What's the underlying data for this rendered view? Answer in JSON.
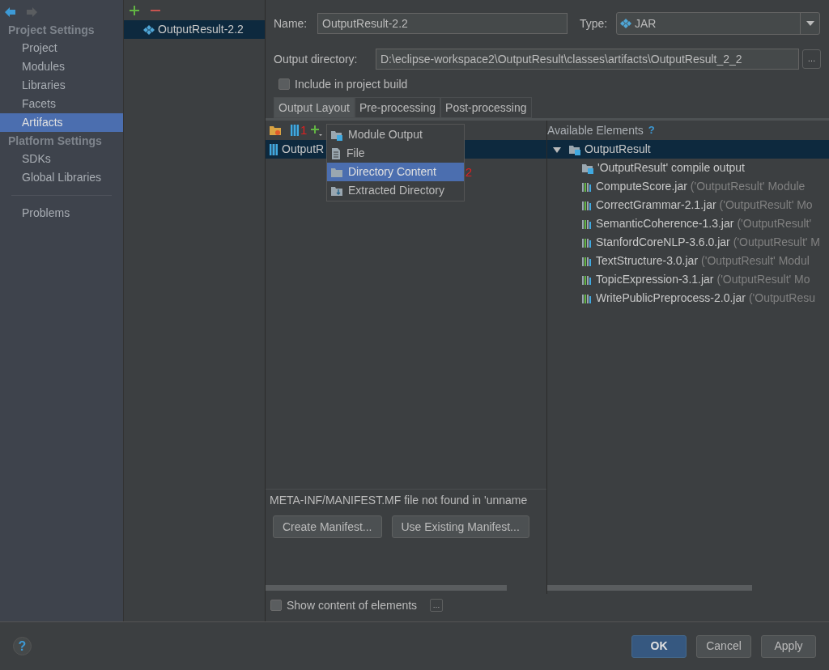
{
  "sidebar": {
    "sections": [
      {
        "title": "Project Settings",
        "items": [
          {
            "label": "Project",
            "selected": false
          },
          {
            "label": "Modules",
            "selected": false
          },
          {
            "label": "Libraries",
            "selected": false
          },
          {
            "label": "Facets",
            "selected": false
          },
          {
            "label": "Artifacts",
            "selected": true
          }
        ]
      },
      {
        "title": "Platform Settings",
        "items": [
          {
            "label": "SDKs",
            "selected": false
          },
          {
            "label": "Global Libraries",
            "selected": false
          }
        ]
      }
    ],
    "extra_items": [
      {
        "label": "Problems",
        "selected": false
      }
    ]
  },
  "artifacts_list": [
    {
      "label": "OutputResult-2.2",
      "selected": true
    }
  ],
  "name_field": {
    "label": "Name:",
    "value": "OutputResult-2.2"
  },
  "type_field": {
    "label": "Type:",
    "value": "JAR"
  },
  "output_directory": {
    "label": "Output directory:",
    "value": "D:\\eclipse-workspace2\\OutputResult\\classes\\artifacts\\OutputResult_2_2",
    "browse": "…"
  },
  "include_in_build": {
    "label": "Include in project build",
    "checked": false
  },
  "tabs": [
    {
      "label": "Output Layout",
      "selected": true
    },
    {
      "label": "Pre-processing",
      "selected": false
    },
    {
      "label": "Post-processing",
      "selected": false
    }
  ],
  "layout_toolbar": {
    "annotation": "1"
  },
  "layout_tree": [
    {
      "label": "OutputR",
      "selected": true
    }
  ],
  "add_menu": {
    "annotation": "2",
    "items": [
      {
        "label": "Module Output",
        "kind": "module",
        "selected": false
      },
      {
        "label": "File",
        "kind": "file",
        "selected": false
      },
      {
        "label": "Directory Content",
        "kind": "directory",
        "selected": true
      },
      {
        "label": "Extracted Directory",
        "kind": "extracted",
        "selected": false
      }
    ]
  },
  "available": {
    "title": "Available Elements",
    "help": "?",
    "tree": [
      {
        "label": "OutputResult",
        "kind": "module",
        "expanded": true,
        "selected": true,
        "children": [
          {
            "label": "'OutputResult' compile output",
            "kind": "output",
            "selected": false
          },
          {
            "label": "ComputeScore.jar",
            "detail": "('OutputResult' Module",
            "kind": "library",
            "selected": false
          },
          {
            "label": "CorrectGrammar-2.1.jar",
            "detail": "('OutputResult' Mo",
            "kind": "library",
            "selected": false
          },
          {
            "label": "SemanticCoherence-1.3.jar",
            "detail": "('OutputResult'",
            "kind": "library",
            "selected": false
          },
          {
            "label": "StanfordCoreNLP-3.6.0.jar",
            "detail": "('OutputResult' M",
            "kind": "library",
            "selected": false
          },
          {
            "label": "TextStructure-3.0.jar",
            "detail": "('OutputResult' Modul",
            "kind": "library",
            "selected": false
          },
          {
            "label": "TopicExpression-3.1.jar",
            "detail": "('OutputResult' Mo",
            "kind": "library",
            "selected": false
          },
          {
            "label": "WritePublicPreprocess-2.0.jar",
            "detail": "('OutputResu",
            "kind": "library",
            "selected": false
          }
        ]
      }
    ]
  },
  "manifest": {
    "message": "META-INF/MANIFEST.MF file not found in 'unname",
    "buttons": [
      "Create Manifest...",
      "Use Existing Manifest..."
    ]
  },
  "show_content": {
    "label": "Show content of elements",
    "checked": false,
    "more": "…"
  },
  "help": "?",
  "buttons": [
    {
      "label": "OK",
      "default": true
    },
    {
      "label": "Cancel",
      "default": false
    },
    {
      "label": "Apply",
      "default": false
    }
  ]
}
